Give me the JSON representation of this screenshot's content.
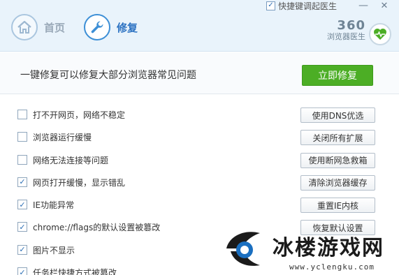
{
  "titlebar": {
    "shortcut_checkbox_checked": true,
    "shortcut_label": "快捷键调起医生",
    "minimize_glyph": "—",
    "close_glyph": "✕"
  },
  "nav": {
    "home_label": "首页",
    "home_icon": "home-icon",
    "repair_label": "修复",
    "repair_icon": "wrench-icon",
    "active": "修复"
  },
  "brand": {
    "number": "360",
    "name": "浏览器医生",
    "logo_icon": "heart-pulse-icon"
  },
  "main": {
    "headline": "一键修复可以修复大部分浏览器常见问题",
    "fix_button_label": "立即修复"
  },
  "issues": [
    {
      "label": "打不开网页，网络不稳定",
      "checked": false,
      "action": "使用DNS优选"
    },
    {
      "label": "浏览器运行缓慢",
      "checked": false,
      "action": "关闭所有扩展"
    },
    {
      "label": "网络无法连接等问题",
      "checked": false,
      "action": "使用断网急救箱"
    },
    {
      "label": "网页打开缓慢，显示错乱",
      "checked": true,
      "action": "清除浏览器缓存"
    },
    {
      "label": "IE功能异常",
      "checked": true,
      "action": "重置IE内核"
    },
    {
      "label": "chrome://flags的默认设置被篡改",
      "checked": true,
      "action": "恢复默认设置"
    },
    {
      "label": "图片不显示",
      "checked": true,
      "action": ""
    },
    {
      "label": "任务栏快捷方式被篡改",
      "checked": true,
      "action": ""
    }
  ],
  "watermark": {
    "title": "冰楼游戏网",
    "url": "www.yclengku.com"
  },
  "colors": {
    "header_bg": "#e9f3fb",
    "accent_blue": "#2c72c2",
    "fix_green": "#4cae25"
  }
}
